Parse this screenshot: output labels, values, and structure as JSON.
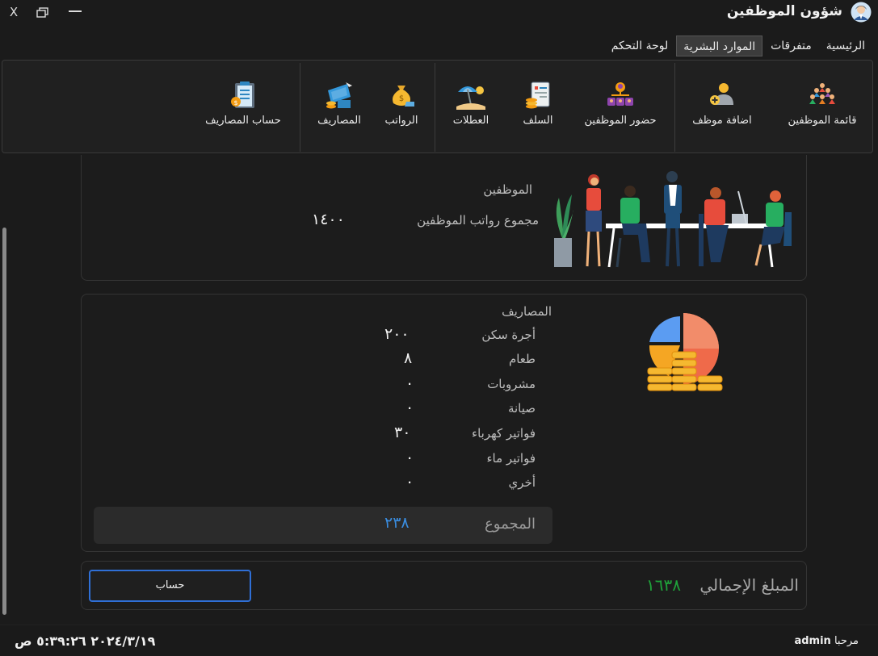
{
  "window": {
    "title": "شؤون الموظفين",
    "close_label": "X"
  },
  "menu": [
    {
      "label": "الرئيسية"
    },
    {
      "label": "متفرقات"
    },
    {
      "label": "الموارد البشرية"
    },
    {
      "label": "لوحة التحكم"
    }
  ],
  "ribbon": [
    {
      "label": "قائمة الموظفين",
      "icon": "people-group-icon"
    },
    {
      "label": "اضافة موظف",
      "icon": "add-user-icon"
    },
    {
      "label": "حضور الموظفين",
      "icon": "org-chart-icon"
    },
    {
      "label": "السلف",
      "icon": "loan-invoice-icon"
    },
    {
      "label": "العطلات",
      "icon": "beach-umbrella-icon"
    },
    {
      "label": "الرواتب",
      "icon": "money-bag-icon"
    },
    {
      "label": "المصاريف",
      "icon": "expenses-icon"
    },
    {
      "label": "حساب المصاريف",
      "icon": "calculator-clipboard-icon"
    }
  ],
  "employees": {
    "title": "الموظفين",
    "salaries_label": "مجموع رواتب الموظفين",
    "salaries_value": "١٤٠٠"
  },
  "expenses": {
    "title": "المصاريف",
    "items": [
      {
        "label": "أجرة سكن",
        "value": "٢٠٠"
      },
      {
        "label": "طعام",
        "value": "٨"
      },
      {
        "label": "مشروبات",
        "value": "٠"
      },
      {
        "label": "صيانة",
        "value": "٠"
      },
      {
        "label": "فواتير كهرباء",
        "value": "٣٠"
      },
      {
        "label": "فواتير ماء",
        "value": "٠"
      },
      {
        "label": "أخري",
        "value": "٠"
      }
    ],
    "total_label": "المجموع",
    "total_value": "٢٣٨"
  },
  "grand": {
    "label": "المبلغ الإجمالي",
    "value": "١٦٣٨",
    "button_label": "حساب"
  },
  "status": {
    "welcome": "مرحبا",
    "user": "admin",
    "datetime": "٢٠٢٤/٣/١٩ ٥:٣٩:٢٦ ص"
  },
  "colors": {
    "accent_blue": "#2f6fd6",
    "total_blue": "#3a8de0",
    "grand_green": "#1fa23a"
  }
}
